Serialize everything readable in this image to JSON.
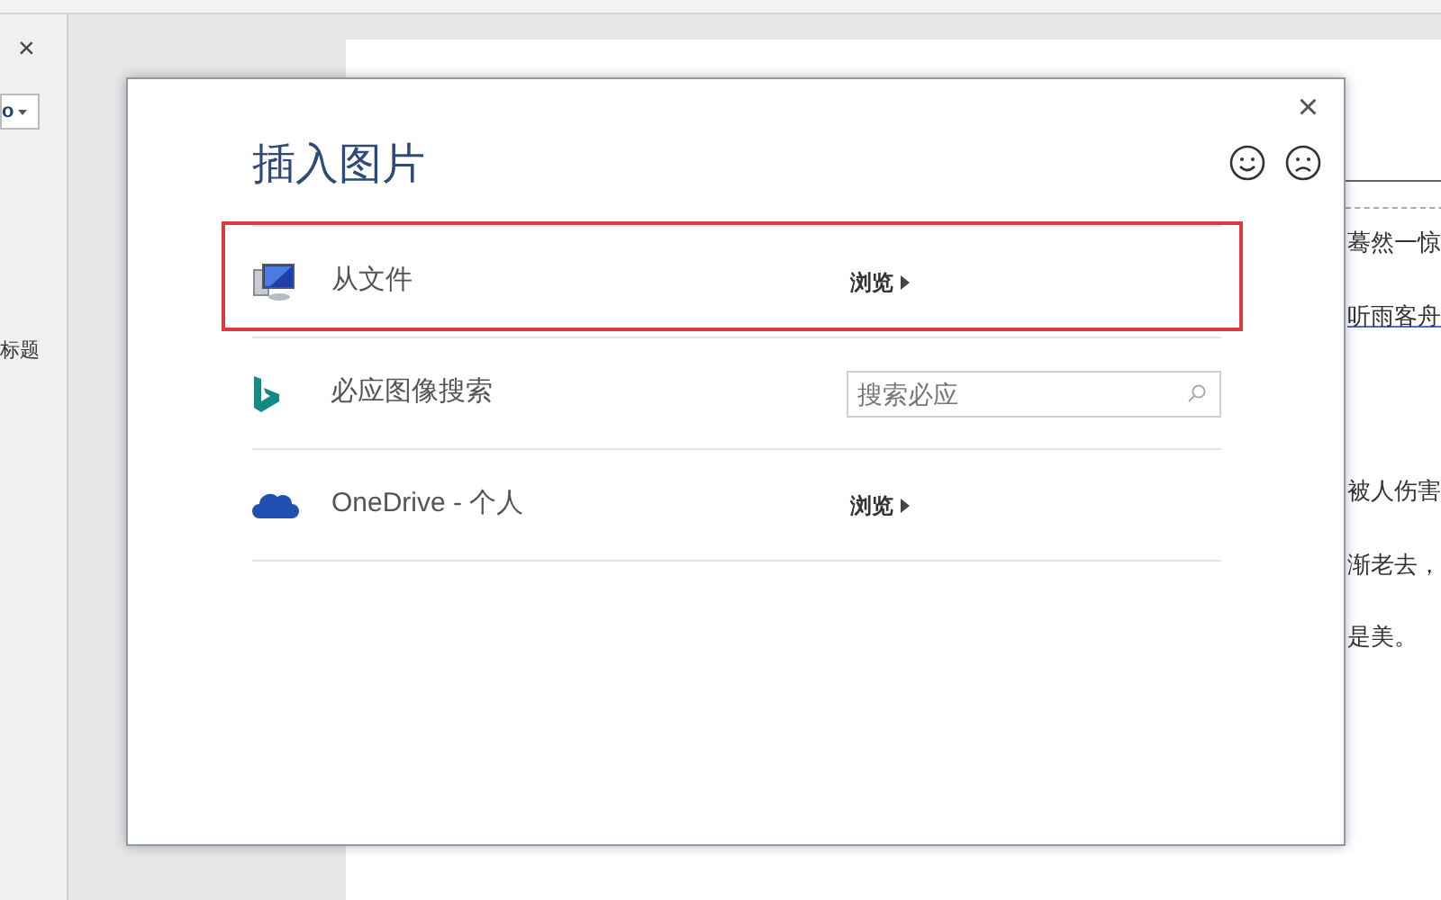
{
  "side_panel": {
    "close": "×",
    "dropdown": "o",
    "heading": "标题"
  },
  "document": {
    "lines": [
      {
        "text": "蓦然一惊",
        "link": false
      },
      {
        "text": "听雨客舟",
        "link": true
      },
      {
        "text": "被人伤害",
        "link": false
      },
      {
        "text": "渐老去，",
        "link": false
      },
      {
        "text": "是美。",
        "link": false
      }
    ]
  },
  "dialog": {
    "title": "插入图片",
    "close": "×",
    "sources": [
      {
        "kind": "file",
        "label": "从文件",
        "action": "浏览",
        "highlighted": true
      },
      {
        "kind": "search",
        "label": "必应图像搜索",
        "placeholder": "搜索必应",
        "highlighted": false
      },
      {
        "kind": "cloud",
        "label": "OneDrive - 个人",
        "action": "浏览",
        "highlighted": false
      }
    ]
  }
}
